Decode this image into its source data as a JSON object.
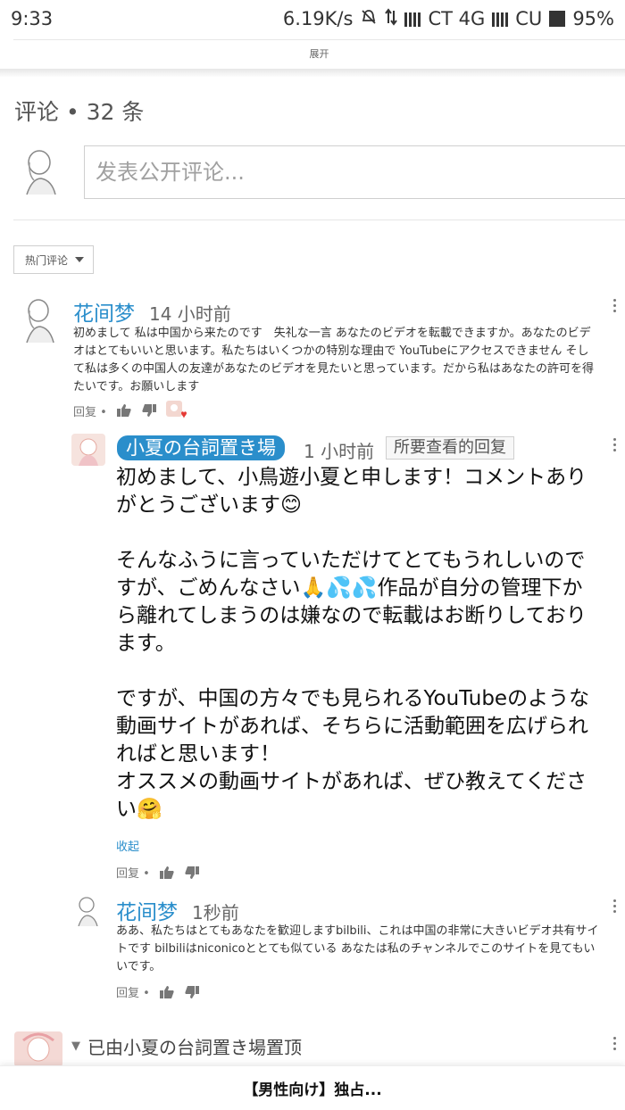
{
  "status_bar": {
    "time": "9:33",
    "net_speed": "6.19K/s",
    "carrier1": "CT 4G",
    "carrier2": "CU",
    "battery": "95%"
  },
  "expand_label": "展开",
  "comments_header": {
    "title": "评论 • 32 条"
  },
  "new_comment": {
    "placeholder": "发表公开评论..."
  },
  "sort": {
    "label": "热门评论"
  },
  "comment1": {
    "author": "花间梦",
    "time": "14 小时前",
    "text": "初めまして 私は中国から来たのです　失礼な一言 あなたのビデオを転載できますか。あなたのビデオはとてもいいと思います。私たちはいくつかの特別な理由で YouTubeにアクセスできません そして私は多くの中国人の友達があなたのビデオを見たいと思っています。だから私はあなたの許可を得たいです。お願いします",
    "reply_label": "回复 •"
  },
  "reply1": {
    "author": "小夏の台詞置き場",
    "time": "1 小时前",
    "tag": "所要查看的回复",
    "text": "初めまして、小鳥遊小夏と申します！コメントありがとうございます😊\n\nそんなふうに言っていただけてとてもうれしいのですが、ごめんなさい🙏💦💦作品が自分の管理下から離れてしまうのは嫌なので転載はお断りしております。\n\nですが、中国の方々でも見られるYouTubeのような動画サイトがあれば、そちらに活動範囲を広げられればと思います！\nオススメの動画サイトがあれば、ぜひ教えてください🤗",
    "collapse": "收起",
    "reply_label": "回复 •"
  },
  "reply2": {
    "author": "花间梦",
    "time": "1秒前",
    "text": "ああ、私たちはとてもあなたを歓迎しますbilbili、これは中国の非常に大きいビデオ共有サイトです bilbiliはniconicoととても似ている あなたは私のチャンネルでこのサイトを見てもいいです。",
    "reply_label": "回复 •"
  },
  "pinned": {
    "text": "已由小夏の台詞置き場置顶"
  },
  "bottom_bar": {
    "title": "【男性向け】独占..."
  },
  "colors": {
    "link_blue": "#2a8ecb",
    "heart_red": "#e53935"
  }
}
